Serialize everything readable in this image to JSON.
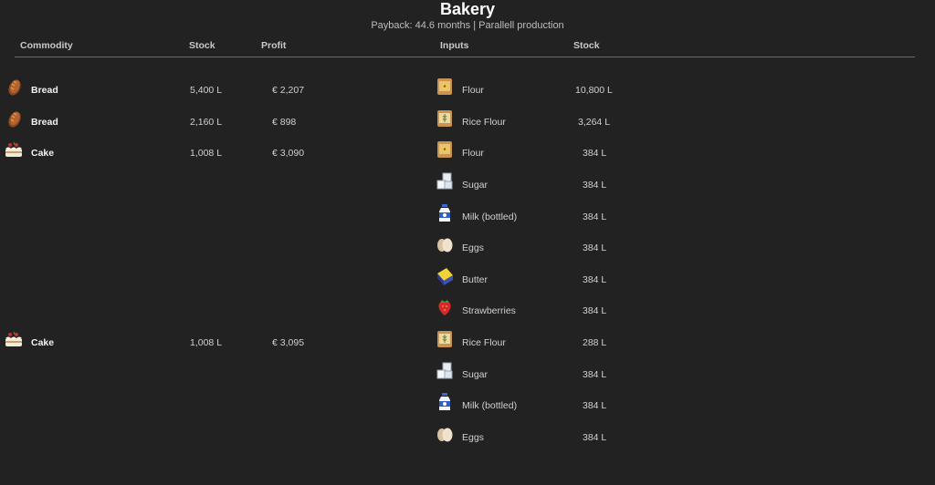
{
  "window": {
    "title": "Bakery",
    "subtitle": "Payback: 44.6 months | Parallell production"
  },
  "headers": {
    "commodity": "Commodity",
    "stock": "Stock",
    "profit": "Profit",
    "inputs": "Inputs",
    "input_stock": "Stock"
  },
  "outputs": [
    {
      "icon": "bread-icon",
      "name": "Bread",
      "stock": "5,400 L",
      "profit": "€ 2,207"
    },
    {
      "icon": "bread-icon",
      "name": "Bread",
      "stock": "2,160 L",
      "profit": "€ 898"
    },
    {
      "icon": "cake-icon",
      "name": "Cake",
      "stock": "1,008 L",
      "profit": "€ 3,090"
    },
    {
      "icon": "cake-icon",
      "name": "Cake",
      "stock": "1,008 L",
      "profit": "€ 3,095"
    }
  ],
  "inputs": [
    {
      "icon": "flour-icon",
      "name": "Flour",
      "stock": "10,800 L"
    },
    {
      "icon": "rice-flour-icon",
      "name": "Rice Flour",
      "stock": "3,264 L"
    },
    {
      "icon": "flour-icon",
      "name": "Flour",
      "stock": "384 L"
    },
    {
      "icon": "sugar-icon",
      "name": "Sugar",
      "stock": "384 L"
    },
    {
      "icon": "milk-bottle-icon",
      "name": "Milk (bottled)",
      "stock": "384 L"
    },
    {
      "icon": "eggs-icon",
      "name": "Eggs",
      "stock": "384 L"
    },
    {
      "icon": "butter-icon",
      "name": "Butter",
      "stock": "384 L"
    },
    {
      "icon": "strawberry-icon",
      "name": "Strawberries",
      "stock": "384 L"
    },
    {
      "icon": "rice-flour-icon",
      "name": "Rice Flour",
      "stock": "288 L"
    },
    {
      "icon": "sugar-icon",
      "name": "Sugar",
      "stock": "384 L"
    },
    {
      "icon": "milk-bottle-icon",
      "name": "Milk (bottled)",
      "stock": "384 L"
    },
    {
      "icon": "eggs-icon",
      "name": "Eggs",
      "stock": "384 L"
    }
  ],
  "colors": {
    "background": "#222222",
    "text": "#d0d0d0",
    "divider": "#6a6a6a"
  }
}
